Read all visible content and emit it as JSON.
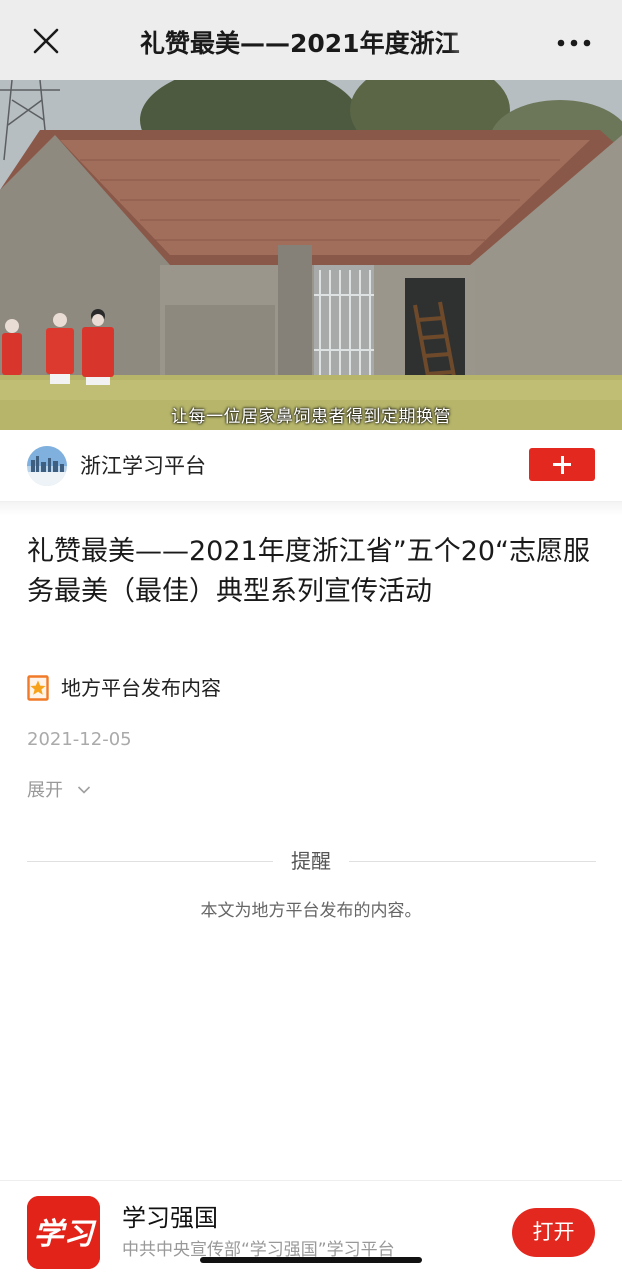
{
  "nav": {
    "title": "礼赞最美——2021年度浙江",
    "close_icon": "close-icon",
    "more_icon": "more-icon"
  },
  "video": {
    "subtitle": "让每一位居家鼻饲患者得到定期换管"
  },
  "channel": {
    "name": "浙江学习平台",
    "follow_icon": "plus-icon",
    "accent": "#e3291f"
  },
  "article": {
    "title": "礼赞最美——2021年度浙江省”五个20“志愿服务最美（最佳）典型系列宣传活动",
    "source_label": "地方平台发布内容",
    "source_icon": "star-bookmark-icon",
    "date": "2021-12-05",
    "expand_label": "展开"
  },
  "reminder": {
    "heading": "提醒",
    "text": "本文为地方平台发布的内容。"
  },
  "app_banner": {
    "logo_text": "学习",
    "app_name": "学习强国",
    "description": "中共中央宣传部“学习强国”学习平台",
    "open_label": "打开"
  }
}
